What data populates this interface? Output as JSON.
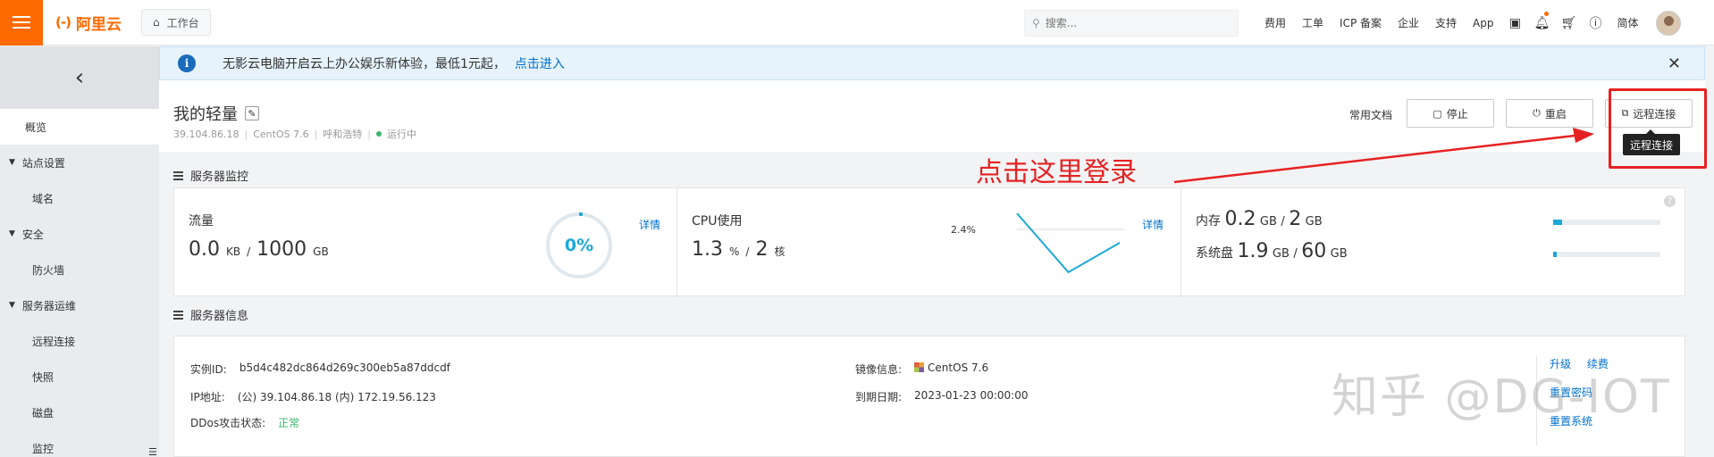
{
  "topbar": {
    "logo_text": "阿里云",
    "logo_mark": "(-)",
    "workbench": "工作台",
    "search_placeholder": "搜索...",
    "links": [
      "费用",
      "工单",
      "ICP 备案",
      "企业",
      "支持",
      "App"
    ],
    "language": "简体",
    "accent_color": "#ff6a00"
  },
  "sidebar": {
    "collapse_icon": "chevron-left-icon",
    "overview": "概览",
    "groups": [
      {
        "label": "站点设置",
        "items": [
          "域名"
        ]
      },
      {
        "label": "安全",
        "items": [
          "防火墙"
        ]
      },
      {
        "label": "服务器运维",
        "items": [
          "远程连接",
          "快照",
          "磁盘",
          "监控"
        ]
      }
    ]
  },
  "notice": {
    "text": "无影云电脑开启云上办公娱乐新体验，最低1元起，",
    "link": "点击进入"
  },
  "header": {
    "title": "我的轻量",
    "ip": "39.104.86.18",
    "os": "CentOS 7.6",
    "region": "呼和浩特",
    "status": "运行中",
    "docs": "常用文档",
    "stop": "停止",
    "restart": "重启",
    "remote": "远程连接",
    "tooltip": "远程连接"
  },
  "monitor": {
    "heading": "服务器监控",
    "traffic": {
      "label": "流量",
      "used": "0.0",
      "used_unit": "KB",
      "total": "1000",
      "total_unit": "GB",
      "percent_text": "0%",
      "detail": "详情"
    },
    "cpu": {
      "label": "CPU使用",
      "value": "1.3",
      "unit": "%",
      "cores": "2",
      "cores_unit": "核",
      "peak_label": "2.4%",
      "detail": "详情",
      "series": [
        2.4,
        0.2,
        1.3
      ]
    },
    "memory": {
      "label": "内存",
      "used": "0.2",
      "unit": "GB",
      "total": "2",
      "fraction": 0.08
    },
    "disk": {
      "label": "系统盘",
      "used": "1.9",
      "unit": "GB",
      "total": "60",
      "fraction": 0.03
    },
    "help": "?"
  },
  "info": {
    "heading": "服务器信息",
    "instance_label": "实例ID:",
    "instance_id": "b5d4c482dc864d269c300eb5a87ddcdf",
    "ip_label": "IP地址:",
    "ip_value": "(公) 39.104.86.18 (内) 172.19.56.123",
    "ddos_label": "DDos攻击状态:",
    "ddos_value": "正常",
    "image_label": "镜像信息:",
    "image_value": "CentOS 7.6",
    "expire_label": "到期日期:",
    "expire_value": "2023-01-23 00:00:00",
    "upgrade": "升级",
    "renew": "续费",
    "reset_password": "重置密码",
    "reset_system": "重置系统"
  },
  "annotation": {
    "text": "点击这里登录",
    "color": "#e62121"
  },
  "watermark": "知乎 @DG-IOT"
}
